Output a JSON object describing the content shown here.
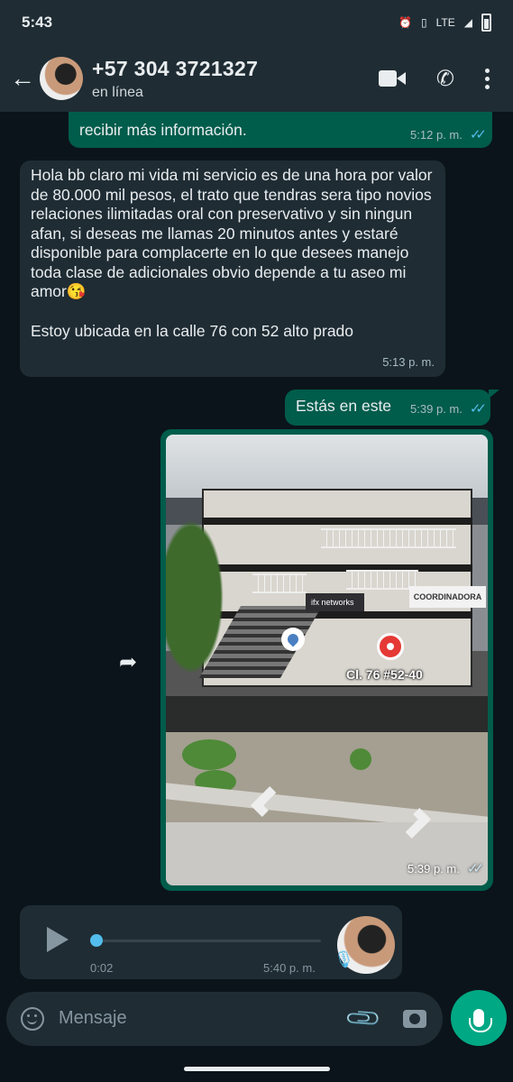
{
  "status_bar": {
    "time": "5:43",
    "network": "LTE"
  },
  "header": {
    "contact_name": "+57 304 3721327",
    "status": "en línea",
    "icons": [
      "back-arrow-icon",
      "video-call-icon",
      "phone-icon",
      "more-icon"
    ]
  },
  "messages": [
    {
      "direction": "out",
      "text": "recibir más información.",
      "time": "5:12 p. m."
    },
    {
      "direction": "in",
      "text": "Hola bb claro mi vida mi servicio es de una hora por valor de 80.000 mil pesos, el trato que tendras sera tipo novios relaciones ilimitadas oral con preservativo y sin ningun afan, si deseas me llamas 20 minutos antes y estaré disponible para complacerte en lo que desees manejo toda clase de adicionales obvio depende a tu aseo mi amor😘",
      "text2": "Estoy ubicada en la calle 76 con 52 alto prado",
      "time": "5:13 p. m."
    },
    {
      "direction": "out",
      "text": "Estás en este",
      "time": "5:39 p. m."
    },
    {
      "direction": "out",
      "type": "location-image",
      "map_label": "Cl. 76 #52-40",
      "sign_left": "ifx networks",
      "sign_right": "COORDINADORA",
      "time": "5:39 p. m."
    }
  ],
  "voice_note": {
    "duration": "0:02",
    "time": "5:40 p. m.",
    "progress": 0
  },
  "input_bar": {
    "placeholder": "Mensaje"
  },
  "colors": {
    "background": "#0b141a",
    "header": "#1f2c34",
    "outgoing_bubble": "#005c4b",
    "incoming_bubble": "#1f2c34",
    "read_ticks": "#53bdeb",
    "accent": "#00a884"
  }
}
